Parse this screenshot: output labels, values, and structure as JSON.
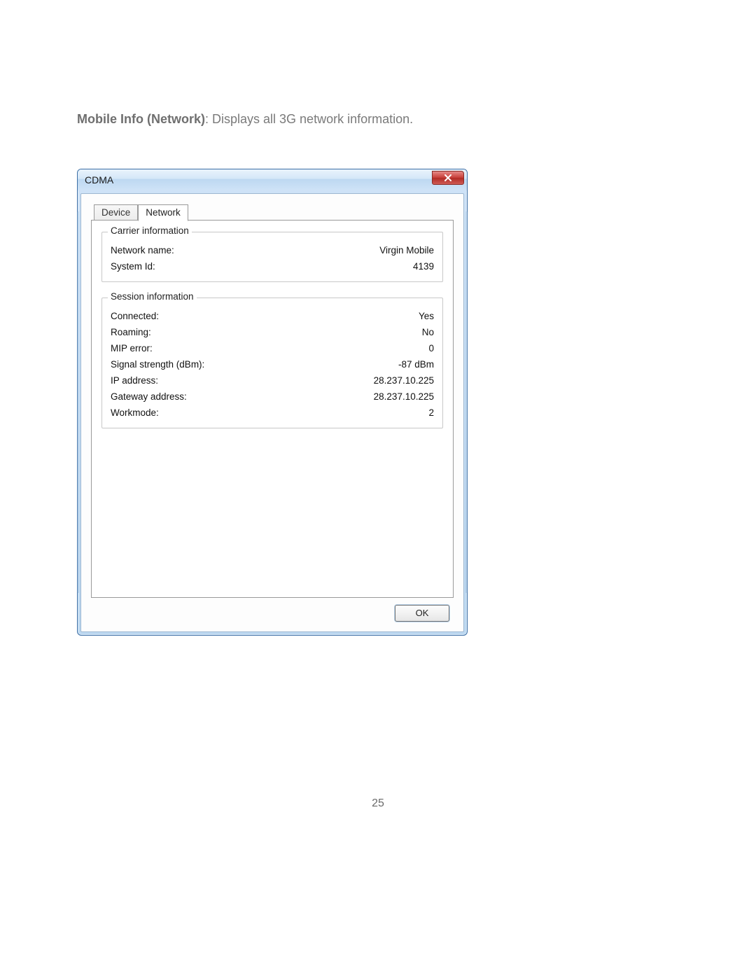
{
  "doc": {
    "heading_bold": "Mobile Info (Network)",
    "heading_rest": ": Displays all 3G network information.",
    "page_number": "25"
  },
  "window": {
    "title": "CDMA",
    "close_tooltip": "Close"
  },
  "tabs": {
    "device": "Device",
    "network": "Network"
  },
  "carrier": {
    "legend": "Carrier information",
    "network_name_label": "Network name:",
    "network_name_value": "Virgin Mobile",
    "system_id_label": "System Id:",
    "system_id_value": "4139"
  },
  "session": {
    "legend": "Session information",
    "connected_label": "Connected:",
    "connected_value": "Yes",
    "roaming_label": "Roaming:",
    "roaming_value": "No",
    "mip_error_label": "MIP error:",
    "mip_error_value": "0",
    "signal_label": "Signal strength (dBm):",
    "signal_value": "-87 dBm",
    "ip_label": "IP address:",
    "ip_value": "28.237.10.225",
    "gateway_label": "Gateway address:",
    "gateway_value": "28.237.10.225",
    "workmode_label": "Workmode:",
    "workmode_value": "2"
  },
  "buttons": {
    "ok": "OK"
  }
}
